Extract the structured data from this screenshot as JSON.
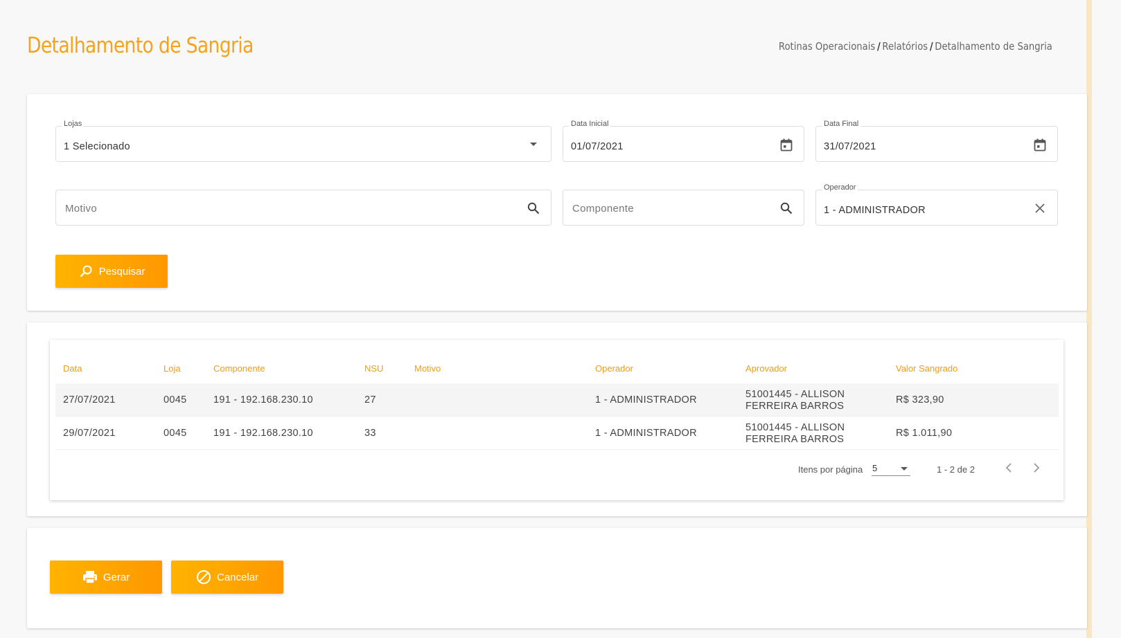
{
  "header": {
    "title": "Detalhamento de Sangria",
    "breadcrumb": [
      "Rotinas Operacionais",
      "Relatórios",
      "Detalhamento de Sangria"
    ],
    "breadcrumb_sep": "/"
  },
  "filters": {
    "lojas": {
      "label": "Lojas",
      "value": "1 Selecionado",
      "icon": "dropdown-arrow-icon"
    },
    "data_inicial": {
      "label": "Data Inicial",
      "value": "01/07/2021",
      "icon": "calendar-icon"
    },
    "data_final": {
      "label": "Data Final",
      "value": "31/07/2021",
      "icon": "calendar-icon"
    },
    "motivo": {
      "placeholder": "Motivo",
      "icon": "search-icon"
    },
    "componente": {
      "placeholder": "Componente",
      "icon": "search-icon"
    },
    "operador": {
      "label": "Operador",
      "value": "1 - ADMINISTRADOR",
      "icon": "close-icon"
    },
    "search_button": "Pesquisar"
  },
  "table": {
    "headers": [
      "Data",
      "Loja",
      "Componente",
      "NSU",
      "Motivo",
      "Operador",
      "Aprovador",
      "Valor Sangrado"
    ],
    "rows": [
      {
        "data": "27/07/2021",
        "loja": "0045",
        "componente": "191 - 192.168.230.10",
        "nsu": "27",
        "motivo": "",
        "operador": "1 - ADMINISTRADOR",
        "aprovador_l1": "51001445 - ALLISON",
        "aprovador_l2": "FERREIRA BARROS",
        "valor": "R$ 323,90"
      },
      {
        "data": "29/07/2021",
        "loja": "0045",
        "componente": "191 - 192.168.230.10",
        "nsu": "33",
        "motivo": "",
        "operador": "1 - ADMINISTRADOR",
        "aprovador_l1": "51001445 - ALLISON",
        "aprovador_l2": "FERREIRA BARROS",
        "valor": "R$ 1.011,90"
      }
    ],
    "paginator": {
      "items_label": "Itens por página",
      "page_size": "5",
      "range": "1 - 2 de 2"
    }
  },
  "actions": {
    "gerar": "Gerar",
    "cancelar": "Cancelar"
  },
  "colors": {
    "accent": "#f7a21b",
    "button_gradient_start": "#ffb300",
    "button_gradient_end": "#ff9800"
  }
}
